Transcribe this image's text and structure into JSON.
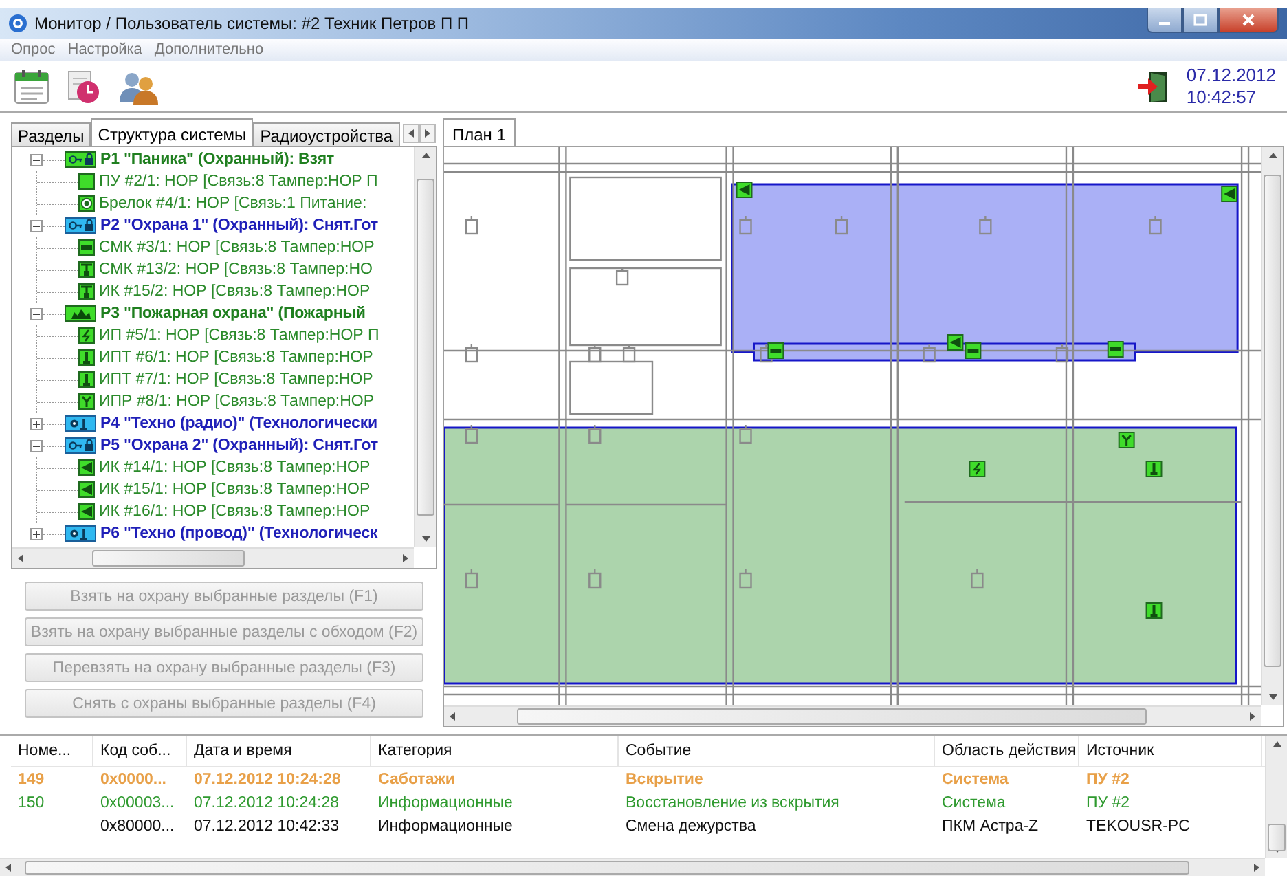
{
  "window": {
    "title": "Монитор / Пользователь системы: #2 Техник Петров П П"
  },
  "menu": [
    "Опрос",
    "Настройка",
    "Дополнительно"
  ],
  "toolbar": {
    "date": "07.12.2012",
    "time": "10:42:57"
  },
  "left_tabs": [
    {
      "label": "Разделы",
      "selected": false
    },
    {
      "label": "Структура системы",
      "selected": true
    },
    {
      "label": "Радиоустройства",
      "selected": false
    }
  ],
  "tree": [
    {
      "label": "P1 \"Паника\" (Охранный): Взят",
      "kind": "security",
      "armed": true,
      "expanded": true,
      "children": [
        {
          "label": "ПУ #2/1: НОР [Связь:8 Тампер:НОР П",
          "kind": "square"
        },
        {
          "label": "Брелок #4/1: НОР [Связь:1 Питание:",
          "kind": "dot"
        }
      ]
    },
    {
      "label": "P2 \"Охрана 1\" (Охранный): Снят.Гот",
      "kind": "security",
      "armed": false,
      "expanded": true,
      "children": [
        {
          "label": "СМК #3/1: НОР [Связь:8 Тампер:НОР",
          "kind": "bar"
        },
        {
          "label": "СМК #13/2: НОР [Связь:8 Тампер:НО",
          "kind": "tee"
        },
        {
          "label": "ИК #15/2: НОР [Связь:8 Тампер:НОР",
          "kind": "tee"
        }
      ]
    },
    {
      "label": "P3 \"Пожарная охрана\" (Пожарный",
      "kind": "fire",
      "armed": true,
      "expanded": true,
      "children": [
        {
          "label": "ИП #5/1: НОР [Связь:8 Тампер:НОР П",
          "kind": "bolt"
        },
        {
          "label": "ИПТ #6/1: НОР [Связь:8 Тампер:НОР",
          "kind": "post"
        },
        {
          "label": "ИПТ #7/1: НОР [Связь:8 Тампер:НОР",
          "kind": "post"
        },
        {
          "label": "ИПР #8/1: НОР [Связь:8 Тампер:НОР",
          "kind": "fork"
        }
      ]
    },
    {
      "label": "P4 \"Техно (радио)\" (Технологически",
      "kind": "tech",
      "armed": false,
      "expanded": false
    },
    {
      "label": "P5 \"Охрана 2\" (Охранный): Снят.Гот",
      "kind": "security",
      "armed": false,
      "expanded": true,
      "children": [
        {
          "label": "ИК #14/1: НОР [Связь:8 Тампер:НОР",
          "kind": "flag"
        },
        {
          "label": "ИК #15/1: НОР [Связь:8 Тампер:НОР",
          "kind": "flag"
        },
        {
          "label": "ИК #16/1: НОР [Связь:8 Тампер:НОР",
          "kind": "flag"
        }
      ]
    },
    {
      "label": "P6 \"Техно (провод)\" (Технологическ",
      "kind": "tech",
      "armed": false,
      "expanded": false
    }
  ],
  "buttons": [
    {
      "label": "Взять на охрану выбранные разделы (F1)",
      "disabled": true
    },
    {
      "label": "Взять на охрану выбранные разделы с обходом (F2)",
      "disabled": true
    },
    {
      "label": "Перевзять на охрану выбранные разделы (F3)",
      "disabled": true
    },
    {
      "label": "Снять с охраны выбранные разделы (F4)",
      "disabled": true
    }
  ],
  "plan": {
    "tabs": [
      {
        "label": "План 1",
        "selected": true
      }
    ],
    "zones": [
      {
        "color": "#aab0f6"
      },
      {
        "color": "#acd4ac"
      }
    ],
    "markers": [
      {
        "kind": "flag"
      },
      {
        "kind": "flag"
      },
      {
        "kind": "bar"
      },
      {
        "kind": "flag"
      },
      {
        "kind": "bar"
      },
      {
        "kind": "bar"
      },
      {
        "kind": "fork"
      },
      {
        "kind": "bolt"
      },
      {
        "kind": "post"
      },
      {
        "kind": "post"
      }
    ]
  },
  "events": {
    "columns": [
      "Номе...",
      "Код соб...",
      "Дата и время",
      "Категория",
      "Событие",
      "Область действия",
      "Источник"
    ],
    "rows": [
      {
        "number": "149",
        "code": "0x0000...",
        "datetime": "07.12.2012 10:24:28",
        "category": "Саботажи",
        "event": "Вскрытие",
        "scope": "Система",
        "source": "ПУ #2",
        "color": "#e8a048",
        "bold": true
      },
      {
        "number": "150",
        "code": "0x00003...",
        "datetime": "07.12.2012 10:24:28",
        "category": "Информационные",
        "event": "Восстановление из вскрытия",
        "scope": "Система",
        "source": "ПУ #2",
        "color": "#2f9a2f",
        "bold": false
      },
      {
        "code": "0x80000...",
        "datetime": "07.12.2012 10:42:33",
        "category": "Информационные",
        "event": "Смена дежурства",
        "scope": "ПКМ Астра-Z",
        "source": "TEKOUSR-PC",
        "color": "#111111",
        "bold": false
      }
    ]
  }
}
